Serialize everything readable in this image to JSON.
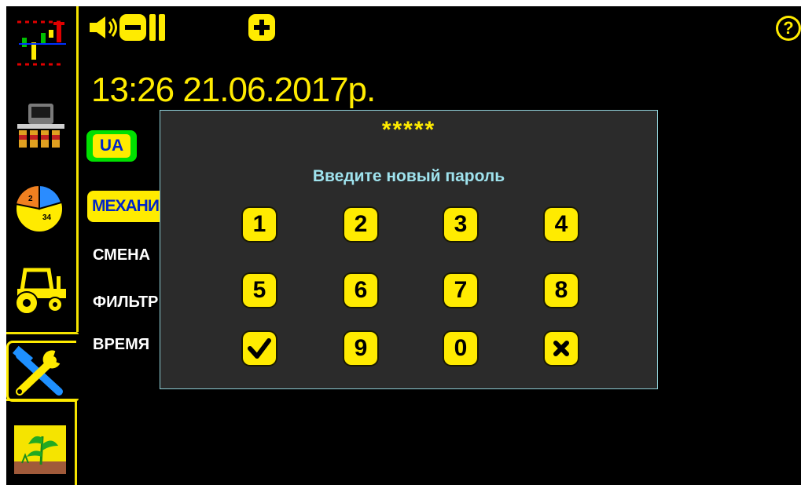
{
  "sidebar": {
    "items": [
      {
        "name": "monitoring-chart-icon",
        "active": false
      },
      {
        "name": "seeder-sensors-icon",
        "active": false
      },
      {
        "name": "area-pie-icon",
        "active": false,
        "pie_labels": [
          "2",
          "34"
        ]
      },
      {
        "name": "tractor-icon",
        "active": false
      },
      {
        "name": "settings-tools-icon",
        "active": true
      },
      {
        "name": "crop-field-icon",
        "active": false
      }
    ]
  },
  "topbar": {
    "volume_icon": "speaker-icon",
    "volume_down_icon": "minus-icon",
    "volume_up_icon": "plus-icon",
    "help_label": "?",
    "datetime": "13:26  21.06.2017р."
  },
  "settings": {
    "language_button": "UA",
    "role_button": "МЕХАНИК",
    "menu": [
      "СМЕНА",
      "ФИЛЬТР",
      "ВРЕМЯ"
    ]
  },
  "password_dialog": {
    "mask": "*****",
    "prompt": "Введите новый пароль",
    "keys": [
      "1",
      "2",
      "3",
      "4",
      "5",
      "6",
      "7",
      "8",
      "confirm",
      "9",
      "0",
      "cancel"
    ],
    "key_labels": {
      "1": "1",
      "2": "2",
      "3": "3",
      "4": "4",
      "5": "5",
      "6": "6",
      "7": "7",
      "8": "8",
      "9": "9",
      "0": "0"
    }
  },
  "colors": {
    "accent": "#ffeb00",
    "background": "#000000",
    "dialog_bg": "#2b2b2b",
    "dialog_border": "#8fd0d8",
    "prompt_text": "#9fe3ee",
    "lang_border": "#00e000",
    "button_text": "#0025c8"
  }
}
